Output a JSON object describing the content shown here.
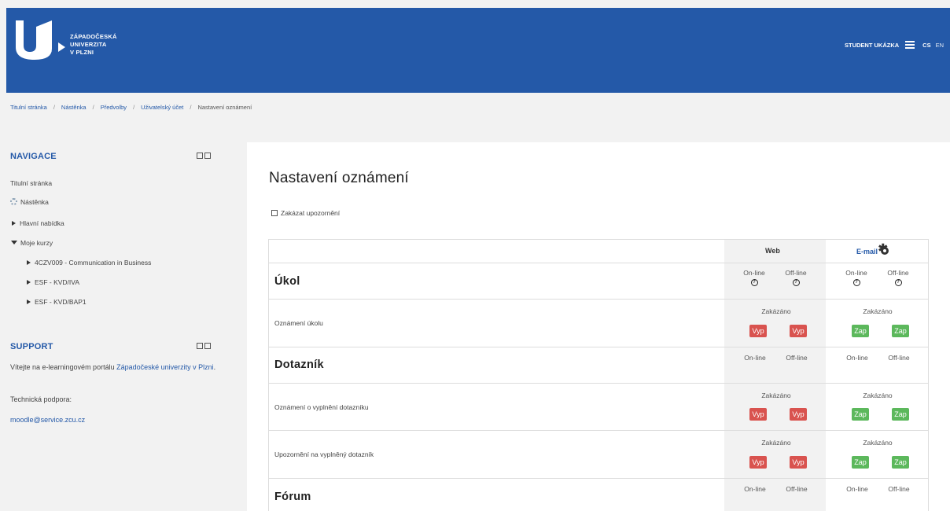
{
  "header": {
    "logo_lines": [
      "ZÁPADOČESKÁ",
      "UNIVERZITA",
      "V PLZNI"
    ],
    "user": "STUDENT UKÁZKA",
    "lang_active": "CS",
    "lang_other": "EN"
  },
  "breadcrumb": [
    "Titulní stránka",
    "Nástěnka",
    "Předvolby",
    "Uživatelský účet",
    "Nastavení oznámení"
  ],
  "sidebar": {
    "nav_title": "NAVIGACE",
    "nav_items": [
      "Titulní stránka",
      "Nástěnka",
      "Hlavní nabídka",
      "Moje kurzy",
      "4CZV009 - Communication in Business",
      "ESF - KVD/IVA",
      "ESF - KVD/BAP1"
    ],
    "support_title": "SUPPORT",
    "support_intro": "Vítejte na e-learningovém portálu",
    "support_link": "Západočeské univerzity v Plzni",
    "support_tech": "Technická podpora:",
    "support_email": "moodle@service.zcu.cz"
  },
  "main": {
    "title": "Nastavení oznámení",
    "disable_label": "Zakázat upozornění"
  },
  "table": {
    "col_web": "Web",
    "col_email": "E-mail",
    "online": "On-line",
    "offline": "Off-line",
    "disabled": "Zakázáno",
    "btn_off": "Vyp",
    "btn_on": "Zap",
    "sections": [
      "Úkol",
      "Dotazník",
      "Fórum"
    ],
    "items": [
      "Oznámení úkolu",
      "Oznámení o vyplnění dotazníku",
      "Upozornění na vyplněný dotazník"
    ]
  },
  "colors": {
    "header_bg": "#2459a8",
    "btn_off": "#d9534f",
    "btn_on": "#5cb85c"
  }
}
